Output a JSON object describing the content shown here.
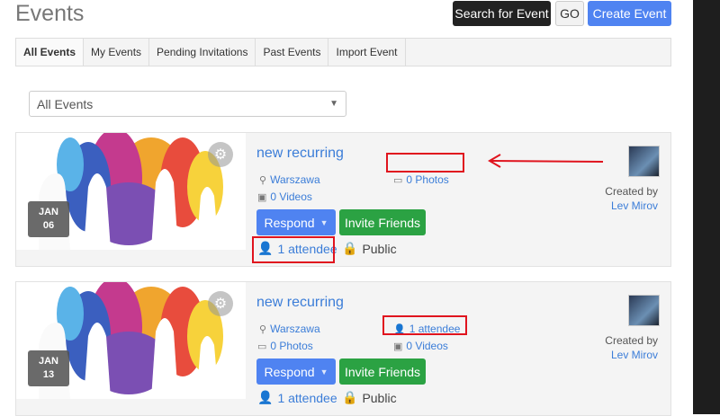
{
  "header": {
    "title": "Events",
    "search_label": "Search for Event",
    "go_label": "GO",
    "create_label": "Create Event"
  },
  "tabs": [
    "All Events",
    "My Events",
    "Pending Invitations",
    "Past Events",
    "Import Event"
  ],
  "filter": {
    "selected": "All Events"
  },
  "events": [
    {
      "month": "JAN",
      "day": "06",
      "title": "new recurring",
      "location": "Warszawa",
      "photos": "0 Photos",
      "videos": "0 Videos",
      "respond_label": "Respond",
      "invite_label": "Invite Friends",
      "attendees": "1 attendee",
      "privacy": "Public",
      "created_by_label": "Created by",
      "creator": "Lev Mirov"
    },
    {
      "month": "JAN",
      "day": "13",
      "title": "new recurring",
      "location": "Warszawa",
      "photos": "0 Photos",
      "videos": "0 Videos",
      "respond_label": "Respond",
      "invite_label": "Invite Friends",
      "attendees": "1 attendee",
      "privacy": "Public",
      "created_by_label": "Created by",
      "creator": "Lev Mirov"
    }
  ],
  "colors": {
    "accent": "#4f83f1",
    "success": "#2ba243",
    "link": "#3b7dd8",
    "annotation": "#e0141e"
  }
}
